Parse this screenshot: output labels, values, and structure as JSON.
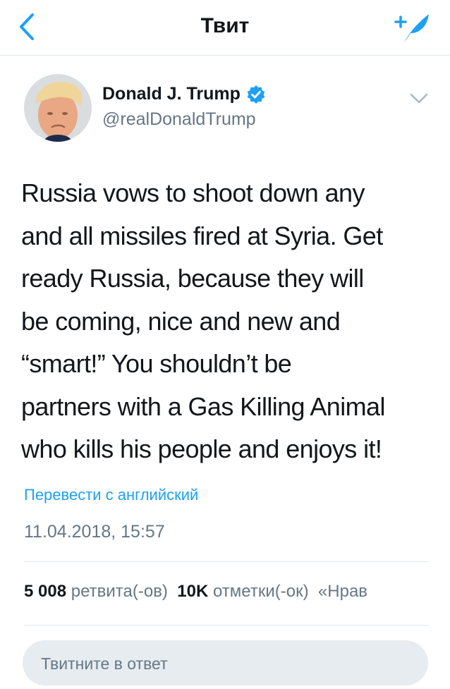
{
  "header": {
    "back_icon": "chevron-left-icon",
    "title": "Твит",
    "compose_icon": "compose-quill-icon"
  },
  "author": {
    "name": "Donald J. Trump",
    "handle": "@realDonaldTrump",
    "verified": true,
    "verified_icon": "verified-badge-icon",
    "avatar_icon": "avatar-photo",
    "more_icon": "chevron-down-icon"
  },
  "tweet": {
    "text": "Russia vows to shoot down any\nand all missiles fired at Syria. Get\nready Russia,  because they will\nbe coming, nice and new and\n“smart!” You shouldn’t be\npartners with a Gas Killing Animal\nwho kills his people and enjoys it!",
    "translate_label": "Перевести с английский",
    "timestamp": "11.04.2018, 15:57"
  },
  "stats": {
    "retweets_count": "5 008",
    "retweets_label": "ретвита(-ов)",
    "likes_count": "10K",
    "likes_label": "отметки(-ок)",
    "extra_label": "«Нрав"
  },
  "reply": {
    "placeholder": "Твитните в ответ"
  },
  "colors": {
    "accent": "#1da1f2",
    "text": "#14171a",
    "secondary": "#657786",
    "divider": "#e1e8ed",
    "input_bg": "#e6ecf0"
  }
}
